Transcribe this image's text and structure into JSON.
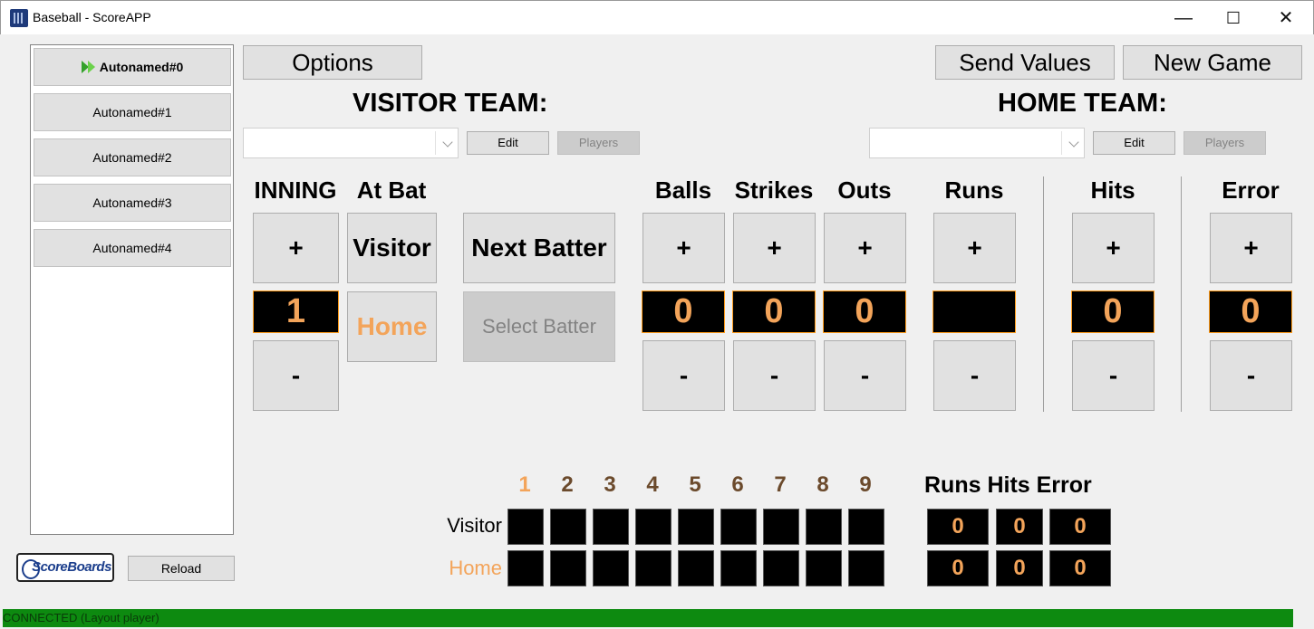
{
  "window": {
    "title": "Baseball - ScoreAPP",
    "minimize": "—",
    "maximize": "☐",
    "close": "✕"
  },
  "sidebar": {
    "items": [
      {
        "label": "Autonamed#0",
        "active": true
      },
      {
        "label": "Autonamed#1"
      },
      {
        "label": "Autonamed#2"
      },
      {
        "label": "Autonamed#3"
      },
      {
        "label": "Autonamed#4"
      }
    ],
    "logo_text": "ScoreBoards",
    "reload_label": "Reload"
  },
  "toolbar": {
    "options_label": "Options",
    "send_values_label": "Send Values",
    "new_game_label": "New Game"
  },
  "visitor_team": {
    "title": "VISITOR TEAM:",
    "selected": "",
    "edit_label": "Edit",
    "players_label": "Players"
  },
  "home_team": {
    "title": "HOME TEAM:",
    "selected": "",
    "edit_label": "Edit",
    "players_label": "Players"
  },
  "controls": {
    "inning": {
      "label": "INNING",
      "plus": "+",
      "minus": "-",
      "value": "1"
    },
    "at_bat": {
      "label": "At Bat",
      "visitor": "Visitor",
      "home": "Home"
    },
    "next_batter_label": "Next Batter",
    "select_batter_label": "Select Batter",
    "balls": {
      "label": "Balls",
      "plus": "+",
      "minus": "-",
      "value": "0"
    },
    "strikes": {
      "label": "Strikes",
      "plus": "+",
      "minus": "-",
      "value": "0"
    },
    "outs": {
      "label": "Outs",
      "plus": "+",
      "minus": "-",
      "value": "0"
    },
    "runs": {
      "label": "Runs",
      "plus": "+",
      "minus": "-",
      "value": ""
    },
    "hits": {
      "label": "Hits",
      "plus": "+",
      "minus": "-",
      "value": "0"
    },
    "error": {
      "label": "Error",
      "plus": "+",
      "minus": "-",
      "value": "0"
    }
  },
  "scoreboard": {
    "innings": [
      "1",
      "2",
      "3",
      "4",
      "5",
      "6",
      "7",
      "8",
      "9"
    ],
    "totals_header": "Runs Hits Error",
    "rows": [
      {
        "label": "Visitor",
        "innings": [
          "",
          "",
          "",
          "",
          "",
          "",
          "",
          "",
          ""
        ],
        "runs": "0",
        "hits": "0",
        "error": "0"
      },
      {
        "label": "Home",
        "innings": [
          "",
          "",
          "",
          "",
          "",
          "",
          "",
          "",
          ""
        ],
        "runs": "0",
        "hits": "0",
        "error": "0"
      }
    ]
  },
  "status": {
    "text": "CONNECTED (Layout player)"
  },
  "colors": {
    "accent_orange": "#f3a45a",
    "inning_brown": "#6b4a2c",
    "status_green": "#0d8a10"
  }
}
